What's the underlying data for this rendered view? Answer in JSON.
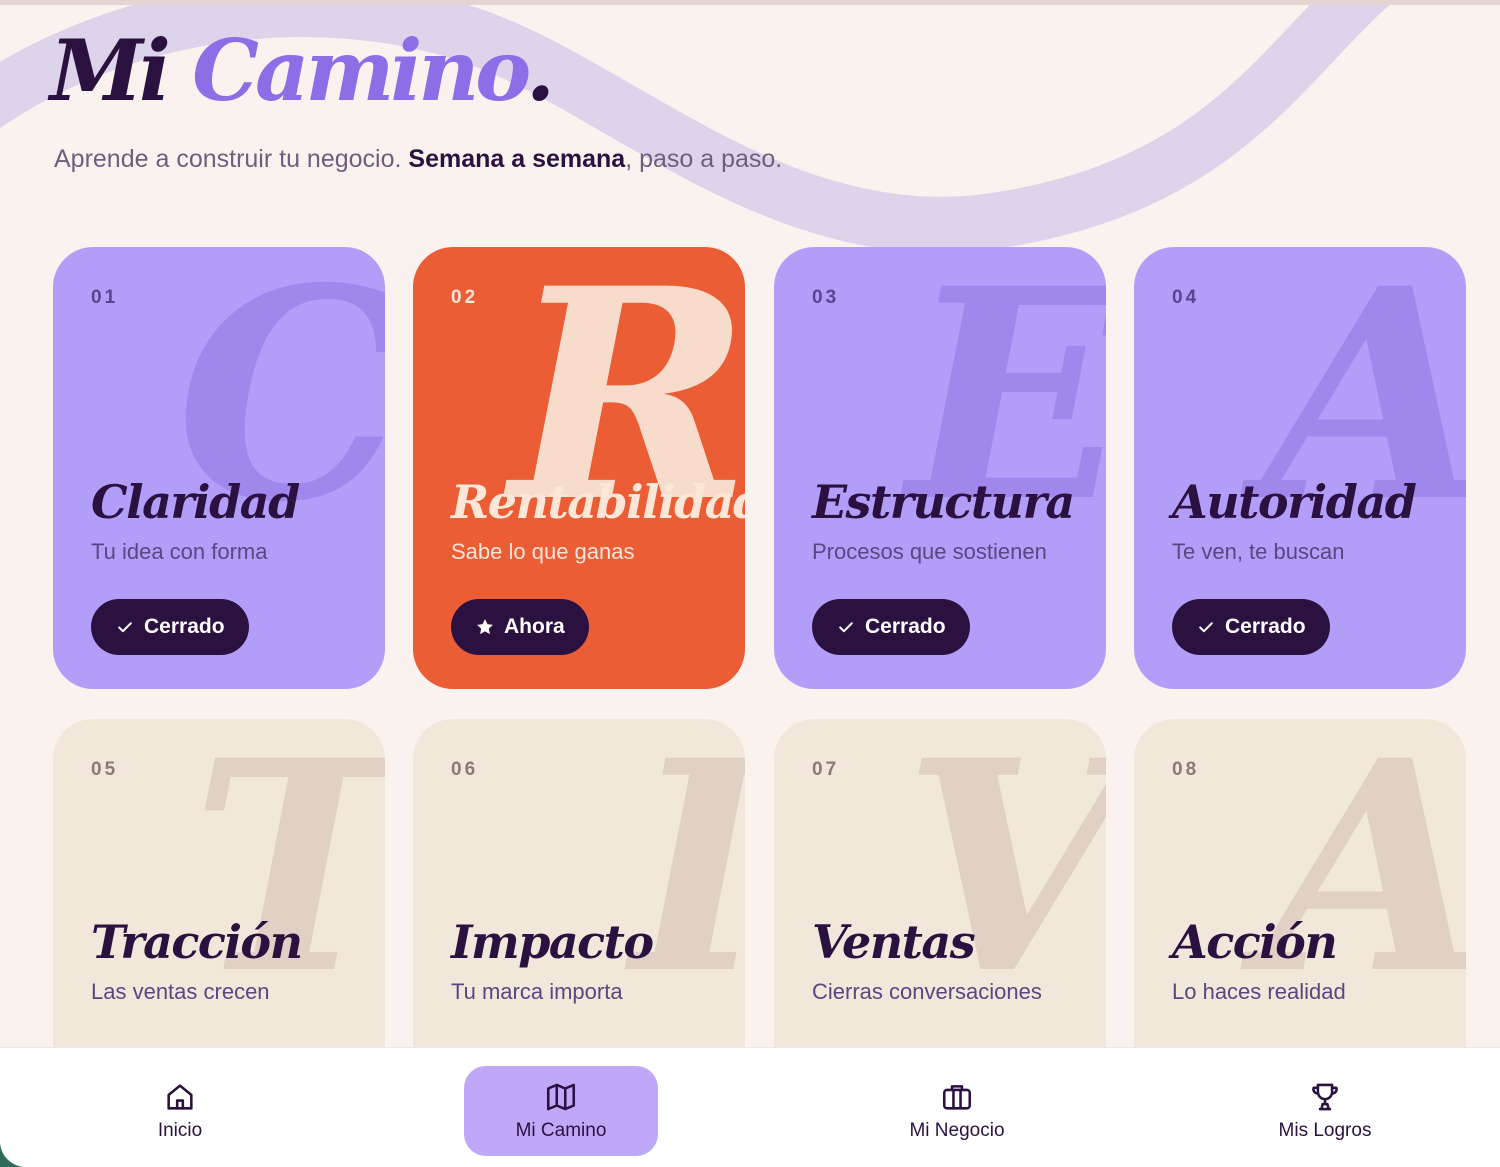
{
  "header": {
    "title_part1": "Mi",
    "title_part2": "Camino",
    "title_dot": ".",
    "subtitle_pre": "Aprende a construir tu negocio. ",
    "subtitle_bold": "Semana a semana",
    "subtitle_post": ", paso a paso."
  },
  "colors": {
    "dark": "#2b1140",
    "accent": "#8c6ee6",
    "card_done": "#b29ef8",
    "card_current": "#ea5d35",
    "card_locked": "#f2e7db",
    "background": "#faf2ee"
  },
  "modules": [
    {
      "number": "01",
      "letter": "C",
      "title": "Claridad",
      "subtitle": "Tu idea con forma",
      "status": "Cerrado",
      "status_icon": "check-icon",
      "state": "done"
    },
    {
      "number": "02",
      "letter": "R",
      "title": "Rentabilidad",
      "subtitle": "Sabe lo que ganas",
      "status": "Ahora",
      "status_icon": "star-icon",
      "state": "current"
    },
    {
      "number": "03",
      "letter": "E",
      "title": "Estructura",
      "subtitle": "Procesos que sostienen",
      "status": "Cerrado",
      "status_icon": "check-icon",
      "state": "done"
    },
    {
      "number": "04",
      "letter": "A",
      "title": "Autoridad",
      "subtitle": "Te ven, te buscan",
      "status": "Cerrado",
      "status_icon": "check-icon",
      "state": "done"
    },
    {
      "number": "05",
      "letter": "T",
      "title": "Tracción",
      "subtitle": "Las ventas crecen",
      "state": "locked"
    },
    {
      "number": "06",
      "letter": "I",
      "title": "Impacto",
      "subtitle": "Tu marca importa",
      "state": "locked"
    },
    {
      "number": "07",
      "letter": "V",
      "title": "Ventas",
      "subtitle": "Cierras conversaciones",
      "state": "locked"
    },
    {
      "number": "08",
      "letter": "A",
      "title": "Acción",
      "subtitle": "Lo haces realidad",
      "state": "locked"
    }
  ],
  "nav": {
    "items": [
      {
        "label": "Inicio",
        "icon": "home-icon",
        "active": false
      },
      {
        "label": "Mi Camino",
        "icon": "map-icon",
        "active": true
      },
      {
        "label": "Mi Negocio",
        "icon": "briefcase-icon",
        "active": false
      },
      {
        "label": "Mis Logros",
        "icon": "trophy-icon",
        "active": false
      }
    ]
  }
}
